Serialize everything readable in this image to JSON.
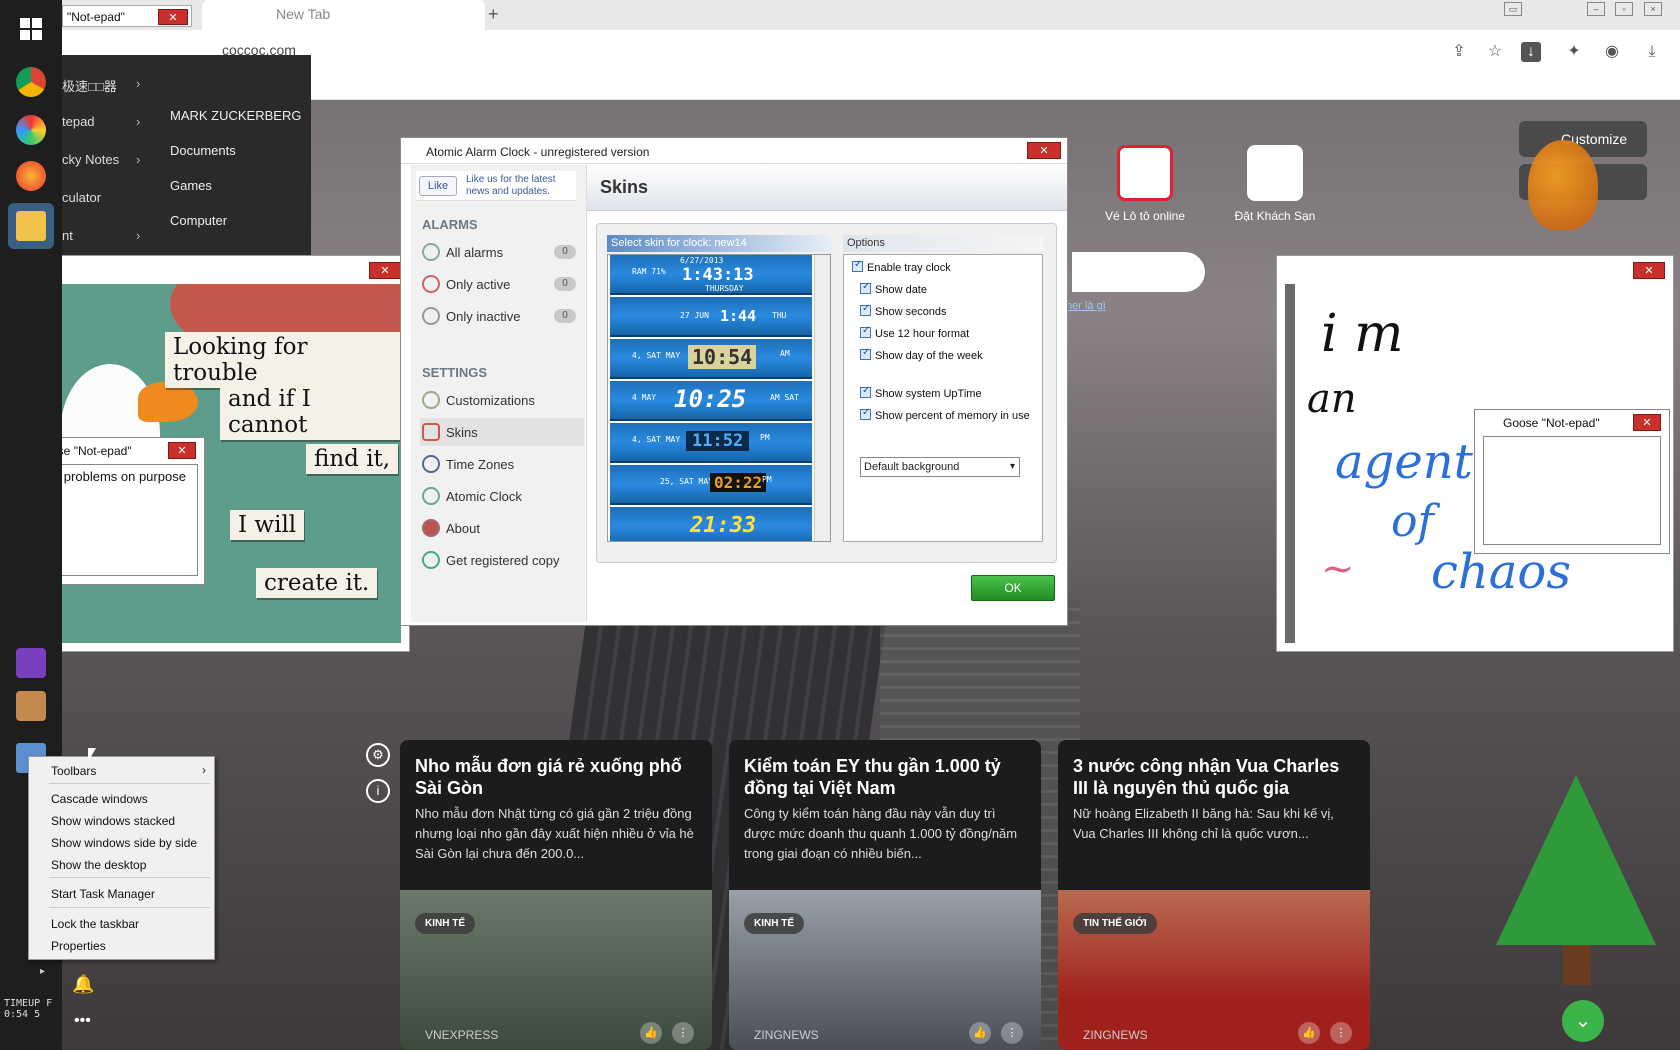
{
  "browser": {
    "tab_title": "New Tab",
    "new_tab": "+",
    "address": "coccoc.com",
    "notepad_strip": "\"Not-epad\""
  },
  "start_menu": {
    "left_items": [
      "极速□□器",
      "tepad",
      "cky Notes",
      "culator",
      "nt"
    ],
    "right_items": [
      "MARK ZUCKERBERG",
      "Documents",
      "Games",
      "Computer"
    ]
  },
  "goose_window": {
    "magnets": [
      "Looking for trouble",
      "and if I cannot",
      "find it,",
      "I will",
      "create it."
    ]
  },
  "goose_notepad_left": {
    "title": "Goose \"Not-epad\"",
    "text": "i cause problems on purpose"
  },
  "goose_notepad_right": {
    "title": "Goose \"Not-epad\""
  },
  "alarm": {
    "title": "Atomic Alarm Clock - unregistered version",
    "like": "Like",
    "like_text": "Like us for the latest news and updates.",
    "alarms_header": "ALARMS",
    "settings_header": "SETTINGS",
    "alarm_items": [
      {
        "label": "All alarms",
        "count": "0"
      },
      {
        "label": "Only active",
        "count": "0"
      },
      {
        "label": "Only inactive",
        "count": "0"
      }
    ],
    "settings_items": [
      "Customizations",
      "Skins",
      "Time Zones",
      "Atomic Clock",
      "About",
      "Get registered copy"
    ],
    "page_title": "Skins",
    "skin_header": "Select skin for clock: new14",
    "options_header": "Options",
    "options": [
      "Enable tray clock",
      "Show date",
      "Show seconds",
      "Use 12 hour format",
      "Show day of the week",
      "Show system UpTime",
      "Show percent of memory in use"
    ],
    "background_select": "Default background",
    "ok": "OK",
    "skins": [
      {
        "date": "6/27/2013",
        "time": "1:43:13",
        "extra": "RAM 71%",
        "day": "THURSDAY"
      },
      {
        "date": "27 JUN",
        "time": "1:44",
        "extra": "",
        "day": "THU"
      },
      {
        "date": "4, SAT MAY",
        "time": "10:54",
        "extra": "",
        "day": "AM"
      },
      {
        "date": "4 MAY",
        "time": "10:25",
        "extra": "",
        "day": "AM SAT"
      },
      {
        "date": "4, SAT MAY",
        "time": "11:52",
        "extra": "",
        "day": "PM"
      },
      {
        "date": "25, SAT MAY",
        "time": "02:22",
        "extra": "",
        "day": "PM"
      },
      {
        "date": "",
        "time": "21:33",
        "extra": "",
        "day": ""
      }
    ]
  },
  "drawing": {
    "lines": [
      "i m",
      "an",
      "agent",
      "of",
      "chaos",
      "~"
    ]
  },
  "shortcuts": [
    {
      "label": "Vé Lô tô online"
    },
    {
      "label": "Đặt Khách Sạn"
    }
  ],
  "customize": "Customize",
  "search_link": "her là gì",
  "news": [
    {
      "title": "Nho mẫu đơn giá rẻ xuống phố Sài Gòn",
      "desc": "Nho mẫu đơn Nhật từng có giá gần 2 triệu đồng nhưng loại nho gần đây xuất hiện nhiều ở vỉa hè Sài Gòn lại chưa đến 200.0...",
      "tag": "KINH TẾ",
      "source": "VNEXPRESS"
    },
    {
      "title": "Kiểm toán EY thu gần 1.000 tỷ đồng tại Việt Nam",
      "desc": "Công ty kiểm toán hàng đầu này vẫn duy trì được mức doanh thu quanh 1.000 tỷ đồng/năm trong giai đoạn có nhiều biến...",
      "tag": "KINH TẾ",
      "source": "ZINGNEWS"
    },
    {
      "title": "3 nước công nhận Vua Charles III là nguyên thủ quốc gia",
      "desc": "Nữ hoàng Elizabeth II băng hà: Sau khi kế vị, Vua Charles III không chỉ là quốc vươn...",
      "tag": "TIN THẾ GIỚI",
      "source": "ZINGNEWS"
    }
  ],
  "context_menu": {
    "toolbars": "Toolbars",
    "items1": [
      "Cascade windows",
      "Show windows stacked",
      "Show windows side by side",
      "Show the desktop"
    ],
    "task_manager": "Start Task Manager",
    "items2": [
      "Lock the taskbar",
      "Properties"
    ]
  },
  "taskbar_clock": "TIMEUP\n0:54",
  "taskbar_clock_line1": "TIMEUP  F",
  "taskbar_clock_line2": "0:54    5",
  "colors": {
    "accent": "#3bb54a",
    "alarm_ok": "#2a9e2a",
    "taskbar": "#1e1e1e"
  }
}
